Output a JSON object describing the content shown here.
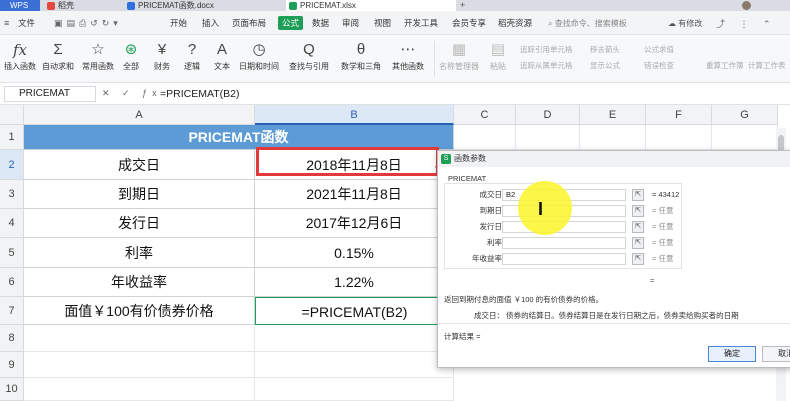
{
  "titlebar": {
    "app": "WPS",
    "tabs": [
      {
        "label": "稻壳"
      },
      {
        "label": "PRICEMAT函数.docx"
      },
      {
        "label": "PRICEMAT.xlsx"
      }
    ]
  },
  "menubar": {
    "file": "文件",
    "items": [
      "开始",
      "插入",
      "页面布局",
      "公式",
      "数据",
      "审阅",
      "视图",
      "开发工具",
      "会员专享",
      "稻壳资源"
    ],
    "search": "查找命令、搜索模板",
    "edit_status": "有修改"
  },
  "ribbon": {
    "buttons": [
      {
        "icon": "fx",
        "label": "插入函数"
      },
      {
        "icon": "Σ",
        "label": "自动求和"
      },
      {
        "icon": "☆",
        "label": "常用函数"
      },
      {
        "icon": "⊛",
        "label": "全部"
      },
      {
        "icon": "¥",
        "label": "财务"
      },
      {
        "icon": "?",
        "label": "逻辑"
      },
      {
        "icon": "A",
        "label": "文本"
      },
      {
        "icon": "◷",
        "label": "日期和时间"
      },
      {
        "icon": "Q",
        "label": "查找与引用"
      },
      {
        "icon": "θ",
        "label": "数学和三角"
      },
      {
        "icon": "⋯",
        "label": "其他函数"
      },
      {
        "icon": "▦",
        "label": "名称管理器"
      },
      {
        "icon": "▤",
        "label": "粘贴"
      }
    ],
    "small_items": [
      "追踪引用单元格",
      "追踪从属单元格",
      "移去箭头",
      "显示公式",
      "公式求值",
      "错误检查",
      "重算工作簿",
      "计算工作表"
    ]
  },
  "formula_bar": {
    "name_box": "PRICEMAT",
    "formula": "=PRICEMAT(B2)"
  },
  "sheet": {
    "columns": [
      "A",
      "B",
      "C",
      "D",
      "E",
      "F",
      "G"
    ],
    "rows": [
      "1",
      "2",
      "3",
      "4",
      "5",
      "6",
      "7",
      "8",
      "9",
      "10"
    ],
    "header": "PRICEMAT函数",
    "data": [
      [
        "成交日",
        "2018年11月8日"
      ],
      [
        "到期日",
        "2021年11月8日"
      ],
      [
        "发行日",
        "2017年12月6日"
      ],
      [
        "利率",
        "0.15%"
      ],
      [
        "年收益率",
        "1.22%"
      ],
      [
        "面值￥100有价债券价格",
        "=PRICEMAT(B2)"
      ]
    ]
  },
  "dialog": {
    "title": "函数参数",
    "func": "PRICEMAT",
    "args": [
      {
        "label": "成交日",
        "value": "B2",
        "result": "= 43412"
      },
      {
        "label": "到期日",
        "value": "",
        "result": "= 任意"
      },
      {
        "label": "发行日",
        "value": "",
        "result": "= 任意"
      },
      {
        "label": "利率",
        "value": "",
        "result": "= 任意"
      },
      {
        "label": "年收益率",
        "value": "",
        "result": "= 任意"
      }
    ],
    "equals": "=",
    "description": "返回到期付息的面值 ￥100 的有价债券的价格。",
    "arg_desc": "成交日：  债券的结算日。债券结算日是在发行日期之后，债券卖给购买者的日期",
    "calc_result": "计算结果 =",
    "ok": "确定",
    "cancel": "取消"
  },
  "colors": {
    "accent": "#1e9e57",
    "header_fill": "#5c9bd5",
    "selection_border": "#e23a3a",
    "highlight": "#faf528"
  }
}
